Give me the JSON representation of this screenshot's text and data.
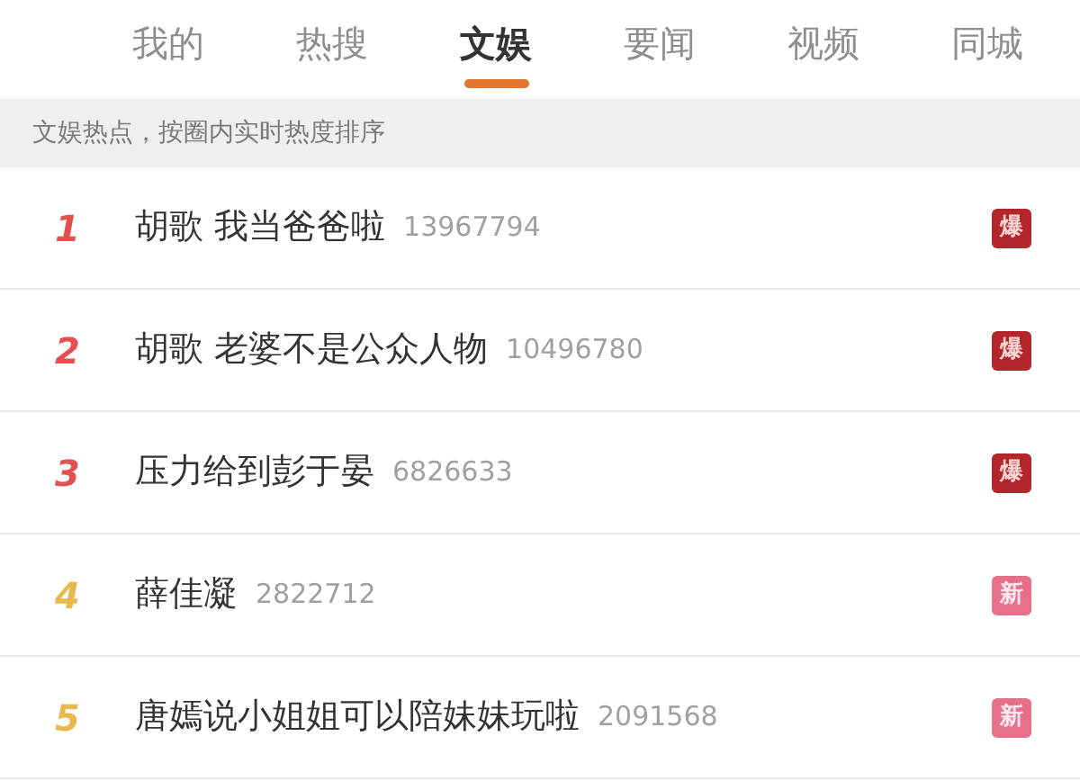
{
  "tabs": [
    {
      "label": "我的",
      "selected": false
    },
    {
      "label": "热搜",
      "selected": false
    },
    {
      "label": "文娱",
      "selected": true
    },
    {
      "label": "要闻",
      "selected": false
    },
    {
      "label": "视频",
      "selected": false
    },
    {
      "label": "同城",
      "selected": false
    }
  ],
  "notice": "文娱热点，按圈内实时热度排序",
  "items": [
    {
      "rank": "1",
      "color": "#e2514f",
      "title": "胡歌 我当爸爸啦",
      "count": "13967794",
      "badge": {
        "kind": "hot",
        "text": "爆"
      }
    },
    {
      "rank": "2",
      "color": "#e2514f",
      "title": "胡歌 老婆不是公众人物",
      "count": "10496780",
      "badge": {
        "kind": "hot",
        "text": "爆"
      }
    },
    {
      "rank": "3",
      "color": "#e2514f",
      "title": "压力给到彭于晏",
      "count": "6826633",
      "badge": {
        "kind": "hot",
        "text": "爆"
      }
    },
    {
      "rank": "4",
      "color": "#e9b84a",
      "title": "薛佳凝",
      "count": "2822712",
      "badge": {
        "kind": "new",
        "text": "新"
      }
    },
    {
      "rank": "5",
      "color": "#e9b84a",
      "title": "唐嫣说小姐姐可以陪妹妹玩啦",
      "count": "2091568",
      "badge": {
        "kind": "new",
        "text": "新"
      }
    }
  ]
}
